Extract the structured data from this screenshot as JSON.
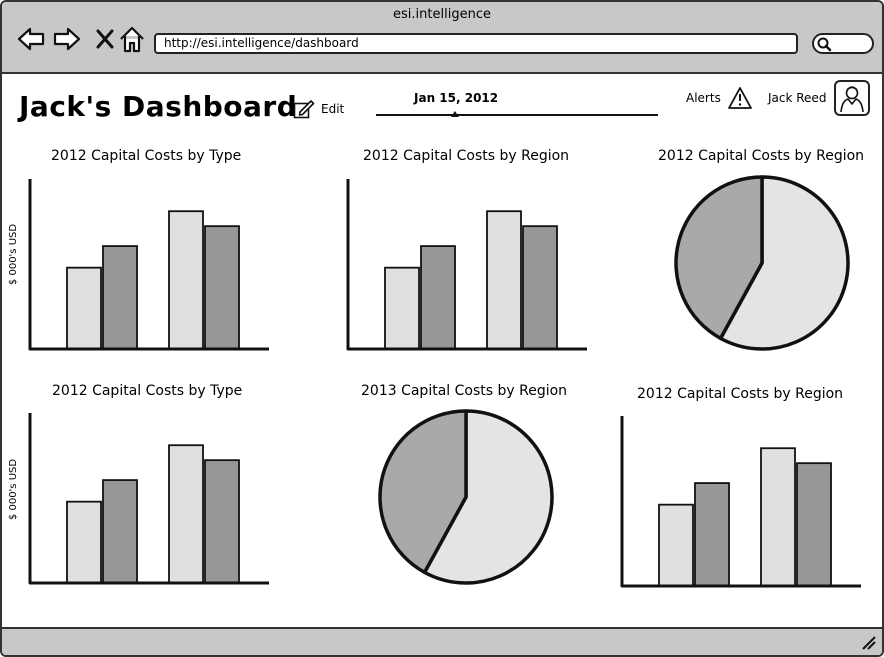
{
  "window": {
    "title": "esi.intelligence"
  },
  "browser": {
    "url": "http://esi.intelligence/dashboard"
  },
  "header": {
    "title": "Jack's Dashboard",
    "edit_label": "Edit",
    "date": "Jan 15, 2012",
    "date_slider_position": 0.28,
    "alerts_label": "Alerts",
    "user_name": "Jack Reed"
  },
  "colors": {
    "light_bar": "#e0e0e0",
    "dark_bar": "#979797",
    "pie_light": "#e4e4e4",
    "pie_dark": "#a9a9a9",
    "chrome": "#c8c8c8"
  },
  "icons": [
    "back-arrow-icon",
    "forward-arrow-icon",
    "close-x-icon",
    "home-icon",
    "search-icon",
    "edit-icon",
    "alert-triangle-icon",
    "user-avatar-icon",
    "resize-grip-icon"
  ],
  "chart_data": [
    {
      "type": "bar",
      "title": "2012 Capital Costs by Type",
      "ylabel": "$ 000's USD",
      "series": [
        {
          "values": [
            49,
            62,
            83,
            74
          ]
        }
      ]
    },
    {
      "type": "bar",
      "title": "2012 Capital Costs by Region",
      "ylabel": "",
      "series": [
        {
          "values": [
            49,
            62,
            83,
            74
          ]
        }
      ]
    },
    {
      "type": "pie",
      "title": "2012 Capital Costs by Region",
      "values": [
        58,
        42
      ]
    },
    {
      "type": "bar",
      "title": "2012 Capital Costs by Type",
      "ylabel": "$ 000's USD",
      "series": [
        {
          "values": [
            49,
            62,
            83,
            74
          ]
        }
      ]
    },
    {
      "type": "pie",
      "title": "2013 Capital Costs by Region",
      "values": [
        58,
        42
      ]
    },
    {
      "type": "bar",
      "title": "2012 Capital Costs by Region",
      "ylabel": "",
      "series": [
        {
          "values": [
            49,
            62,
            83,
            74
          ]
        }
      ]
    }
  ]
}
